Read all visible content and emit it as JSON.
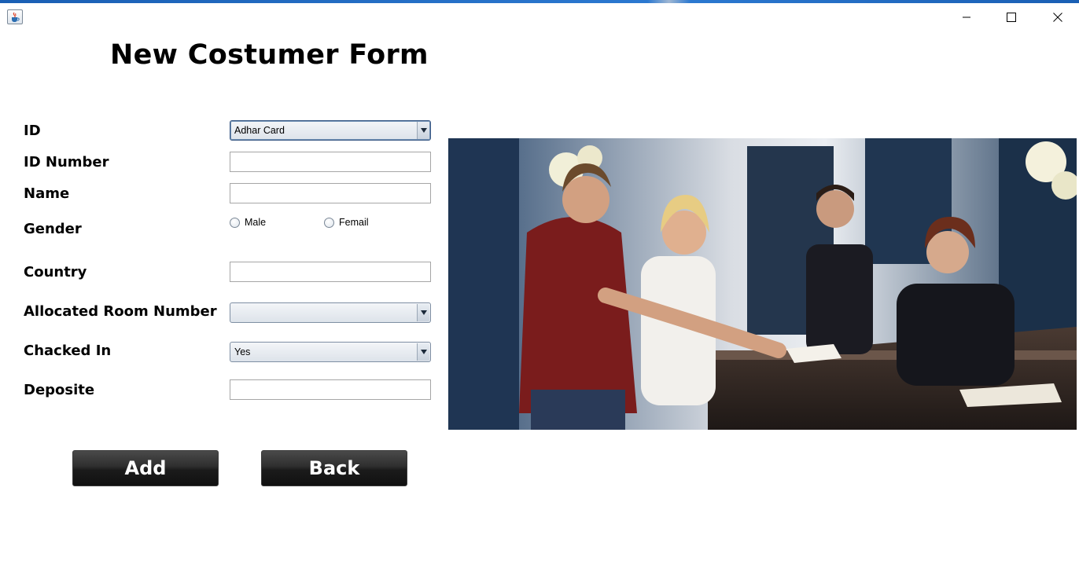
{
  "window": {
    "app_icon": "java-coffee-cup-icon",
    "controls": [
      "minimize-icon",
      "maximize-icon",
      "close-icon"
    ]
  },
  "form": {
    "title": "New Costumer Form",
    "labels": {
      "id": "ID",
      "id_number": "ID Number",
      "name": "Name",
      "gender": "Gender",
      "country": "Country",
      "room": "Allocated Room Number",
      "checked_in": "Chacked In",
      "deposit": "Deposite"
    },
    "id_type_selected": "Adhar Card",
    "id_number_value": "",
    "name_value": "",
    "gender_options": [
      "Male",
      "Femail"
    ],
    "country_value": "",
    "room_selected": "",
    "checked_in_selected": "Yes",
    "deposit_value": ""
  },
  "buttons": {
    "add": "Add",
    "back": "Back"
  },
  "colors": {
    "title_strip": "#1a5fb4",
    "button_bg": "#1b1b1b",
    "button_text": "#ffffff"
  }
}
